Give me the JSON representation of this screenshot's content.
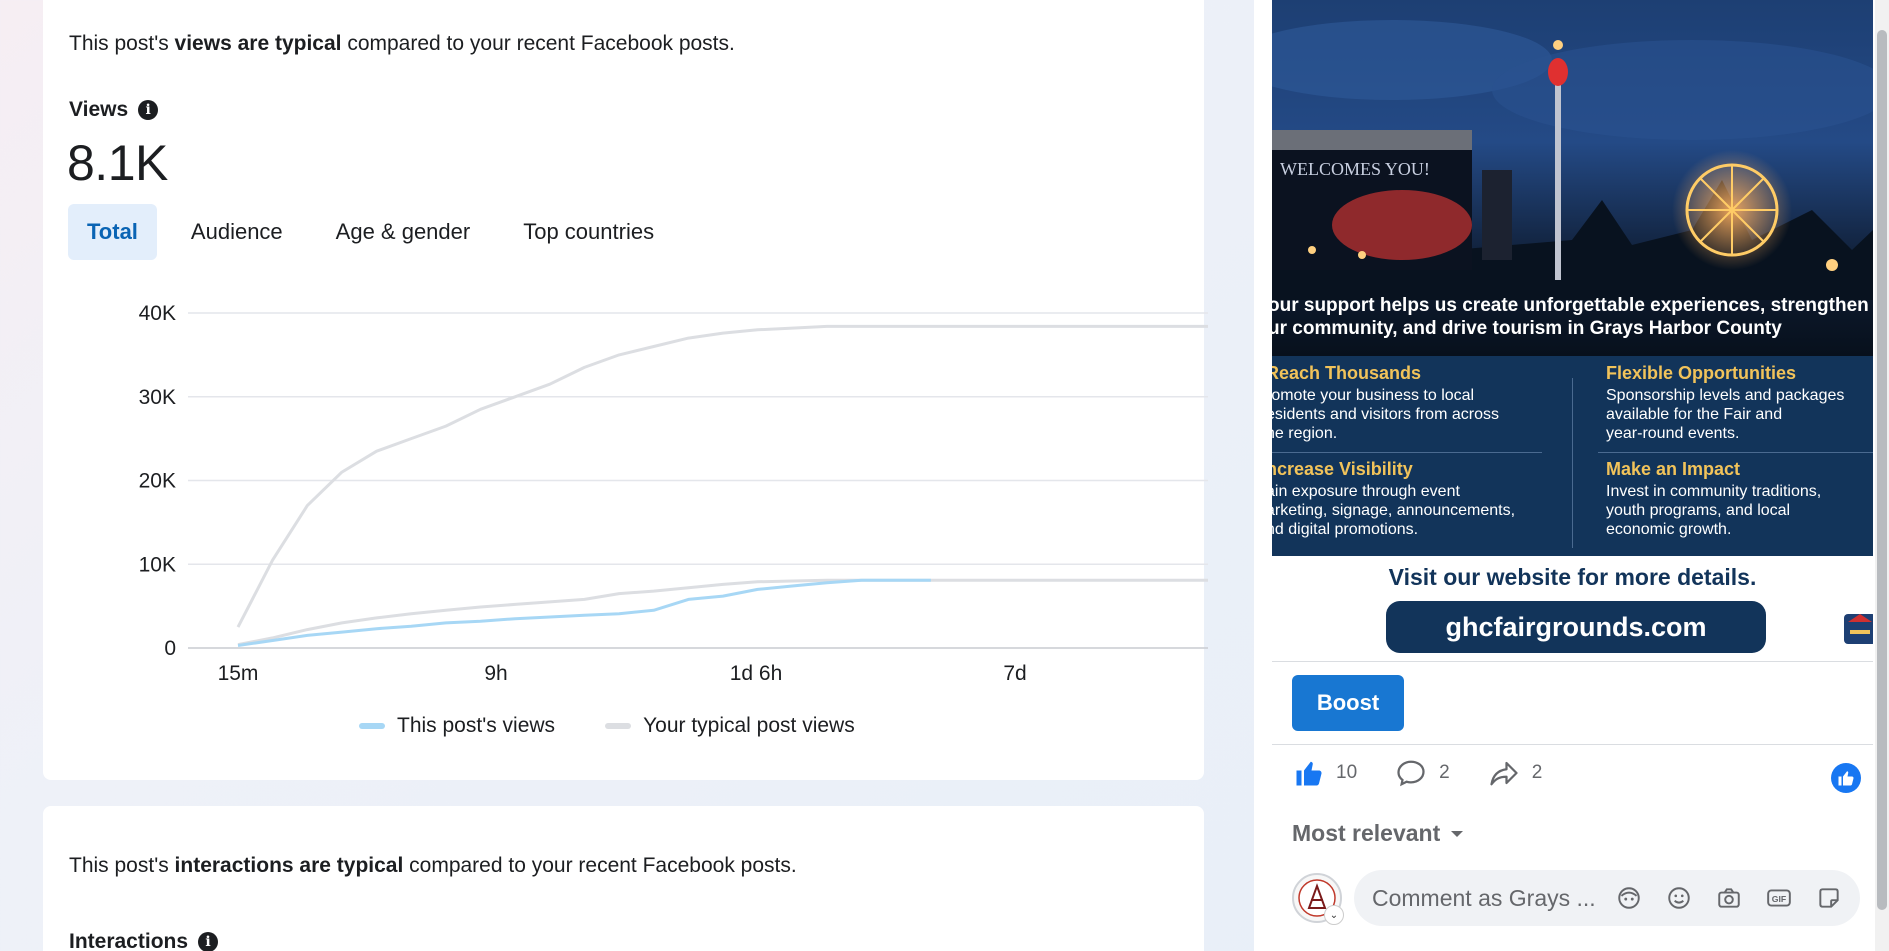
{
  "views_card": {
    "summary_pre": "This post's ",
    "summary_bold": "views are typical",
    "summary_post": " compared to your recent Facebook posts.",
    "metric_label": "Views",
    "metric_value": "8.1K",
    "tabs": [
      {
        "label": "Total",
        "active": true
      },
      {
        "label": "Audience",
        "active": false
      },
      {
        "label": "Age & gender",
        "active": false
      },
      {
        "label": "Top countries",
        "active": false
      }
    ]
  },
  "chart_data": {
    "type": "line",
    "ylim": [
      0,
      40000
    ],
    "yticks": [
      "0",
      "10K",
      "20K",
      "30K",
      "40K"
    ],
    "xticks": [
      "15m",
      "9h",
      "1d 6h",
      "7d"
    ],
    "grid": true,
    "legend_position": "bottom",
    "series": [
      {
        "name": "This post's views",
        "color": "#a7d7f5",
        "x": [
          0,
          0.05,
          0.1,
          0.15,
          0.2,
          0.25,
          0.3,
          0.35,
          0.4,
          0.45,
          0.5,
          0.55,
          0.6,
          0.65,
          0.7,
          0.75,
          0.8,
          0.85,
          0.9,
          0.95,
          1.0
        ],
        "values": [
          300,
          900,
          1500,
          1900,
          2300,
          2600,
          3000,
          3200,
          3500,
          3700,
          3900,
          4100,
          4500,
          5800,
          6200,
          7000,
          7400,
          7800,
          8100,
          8100,
          8100
        ]
      },
      {
        "name": "Your typical post views",
        "color": "#dcdee2",
        "x": [
          0,
          0.05,
          0.1,
          0.15,
          0.2,
          0.25,
          0.3,
          0.35,
          0.4,
          0.45,
          0.5,
          0.55,
          0.6,
          0.65,
          0.7,
          0.75,
          0.8,
          0.85,
          0.9,
          0.95,
          1.0,
          1.1,
          1.2,
          1.3,
          1.4
        ],
        "values": [
          2500,
          10500,
          17000,
          21000,
          23500,
          25000,
          26500,
          28500,
          30000,
          31500,
          33500,
          35000,
          36000,
          37000,
          37600,
          38000,
          38200,
          38400,
          38400,
          38400,
          38400,
          38400,
          38400,
          38400,
          38400
        ],
        "low_values": [
          400,
          1200,
          2200,
          3000,
          3600,
          4100,
          4500,
          4900,
          5200,
          5500,
          5800,
          6500,
          6800,
          7200,
          7600,
          7900,
          8000,
          8100,
          8100,
          8100,
          8100,
          8100,
          8100,
          8100,
          8100
        ]
      }
    ]
  },
  "interactions_card": {
    "summary_pre": "This post's ",
    "summary_bold": "interactions are typical",
    "summary_post": " compared to your recent Facebook posts.",
    "metric_label": "Interactions"
  },
  "post": {
    "image_headline_line1": "our support helps us create unforgettable experiences, strengthen",
    "image_headline_line2": "ur community, and drive tourism in Grays Harbor County",
    "stage_sign": "WELCOMES YOU!",
    "features": [
      {
        "title": "Reach Thousands",
        "text": "romote your business to local\nesidents and visitors from across\nhe region."
      },
      {
        "title": "Flexible Opportunities",
        "text": "Sponsorship levels and packages\navailable for the Fair and\nyear-round events."
      },
      {
        "title": "ncrease Visibility",
        "text": "ain exposure through event\narketing, signage, announcements,\nnd digital promotions."
      },
      {
        "title": "Make an Impact",
        "text": "Invest in community traditions,\nyouth programs, and local\neconomic growth."
      }
    ],
    "visit_text": "Visit our website for more details.",
    "website": "ghcfairgrounds.com",
    "boost_label": "Boost",
    "likes": "10",
    "comments": "2",
    "shares": "2",
    "sort_label": "Most relevant",
    "comment_placeholder": "Comment as Grays ..."
  },
  "colors": {
    "accent": "#1877d2",
    "tab_active_bg": "#e3eefb",
    "tab_active_text": "#0a64b4",
    "post_navy": "#12345a",
    "feature_gold": "#f1c35a"
  }
}
